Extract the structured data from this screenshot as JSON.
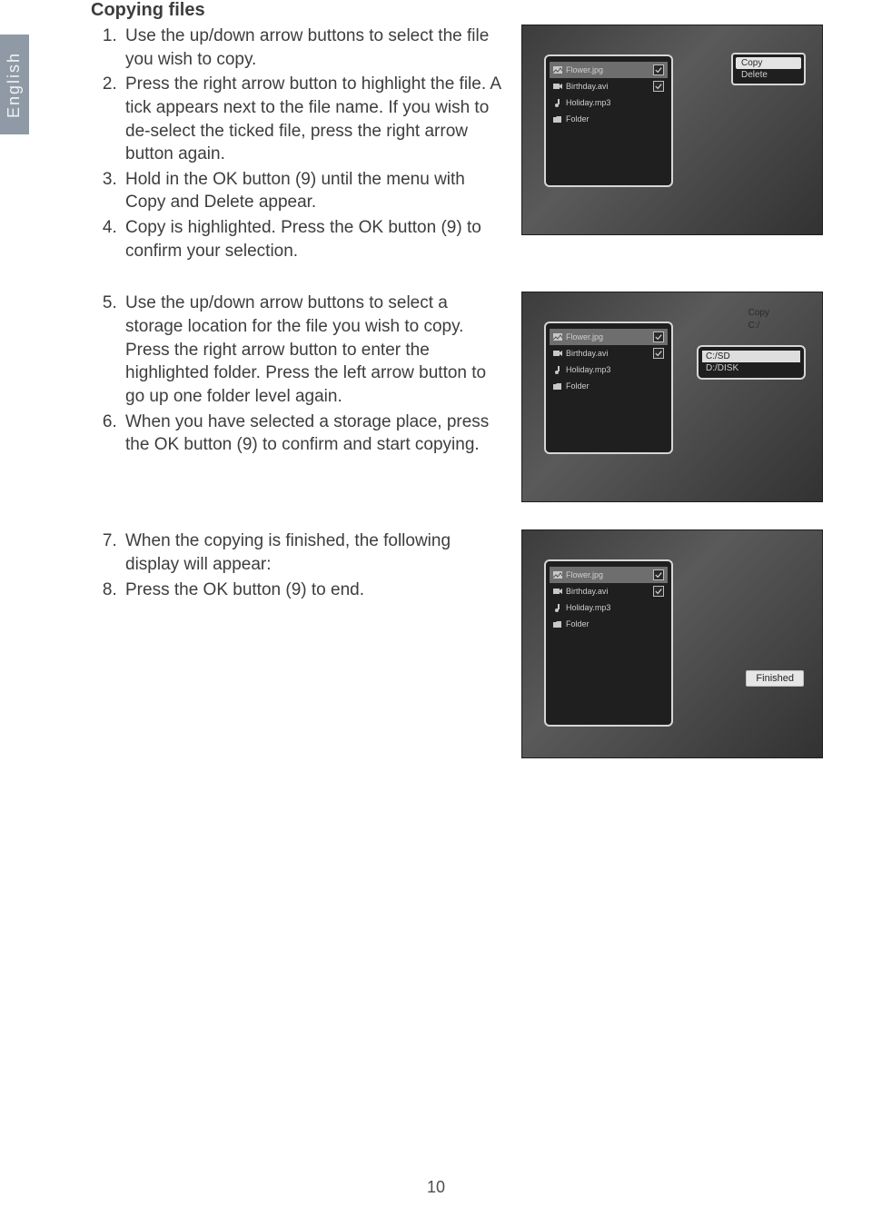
{
  "side_tab": "English",
  "heading": "Copying files",
  "steps_a": [
    "Use the up/down arrow buttons to select the file you wish to copy.",
    "Press the right arrow button to highlight the file. A tick appears next to the file name. If you wish to de-select the ticked file, press the right arrow button again.",
    "Hold in the OK button (9) until the menu with Copy and Delete appear.",
    "Copy is highlighted. Press the OK button (9) to confirm your selection."
  ],
  "steps_b": [
    "Use the up/down arrow buttons to select a storage location for the file you wish to copy. Press the right arrow button to enter the highlighted folder. Press the left arrow button to go up one folder level again.",
    "When you have selected a storage place, press the OK button (9) to confirm and start copying."
  ],
  "steps_c": [
    "When the copying is finished, the following display will appear:",
    "Press the OK button (9) to end."
  ],
  "fig_files": {
    "items": [
      {
        "label": "Flower.jpg",
        "icon": "image",
        "selected": true,
        "tick": true
      },
      {
        "label": "Birthday.avi",
        "icon": "video",
        "selected": false,
        "tick": true
      },
      {
        "label": "Holiday.mp3",
        "icon": "audio",
        "selected": false,
        "tick": false
      },
      {
        "label": "Folder",
        "icon": "folder",
        "selected": false,
        "tick": false
      }
    ]
  },
  "fig1_popup": {
    "copy": "Copy",
    "delete": "Delete"
  },
  "fig2_header": {
    "copy": "Copy",
    "path": "C:/"
  },
  "fig2_dest": {
    "opt1": "C:/SD",
    "opt2": "D:/DISK"
  },
  "fig3_finished": "Finished",
  "page_number": "10"
}
